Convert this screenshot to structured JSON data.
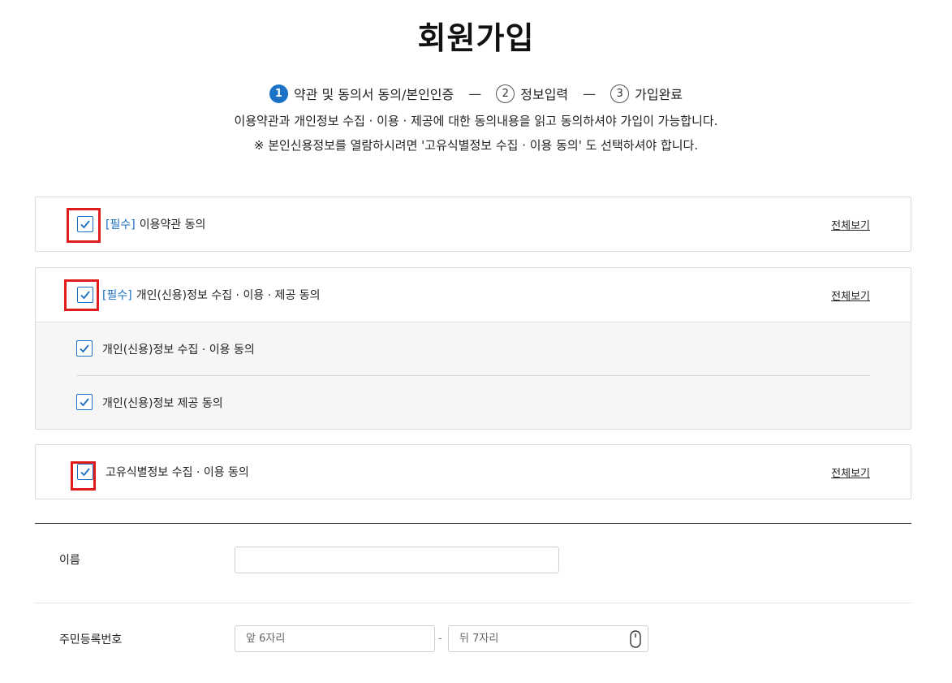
{
  "page": {
    "title": "회원가입"
  },
  "steps": [
    {
      "num": "1",
      "label": "약관 및 동의서 동의/본인인증",
      "active": true
    },
    {
      "num": "2",
      "label": "정보입력",
      "active": false
    },
    {
      "num": "3",
      "label": "가입완료",
      "active": false
    }
  ],
  "step_separator": "—",
  "description": {
    "line1": "이용약관과 개인정보 수집 · 이용 · 제공에 대한 동의내용을 읽고 동의하셔야 가입이 가능합니다.",
    "line2": "※ 본인신용정보를 열람하시려면 '고유식별정보 수집 · 이용 동의' 도 선택하셔야 합니다."
  },
  "agreements": {
    "terms": {
      "tag": "[필수]",
      "label": "이용약관 동의",
      "checked": true,
      "view_all": "전체보기"
    },
    "personal": {
      "tag": "[필수]",
      "label": "개인(신용)정보 수집 · 이용 · 제공 동의",
      "checked": true,
      "view_all": "전체보기",
      "sub_items": [
        {
          "label": "개인(신용)정보 수집 · 이용 동의",
          "checked": true
        },
        {
          "label": "개인(신용)정보 제공 동의",
          "checked": true
        }
      ]
    },
    "unique_id": {
      "label": "고유식별정보 수집 · 이용 동의",
      "checked": true,
      "view_all": "전체보기"
    }
  },
  "form": {
    "name_label": "이름",
    "name_value": "",
    "rrn_label": "주민등록번호",
    "rrn_front_placeholder": "앞 6자리",
    "rrn_dash": "-",
    "rrn_back_placeholder": "뒤 7자리"
  },
  "colors": {
    "accent": "#1a6fc0",
    "highlight": "#e01b1b",
    "step_active": "#1a73c7"
  }
}
